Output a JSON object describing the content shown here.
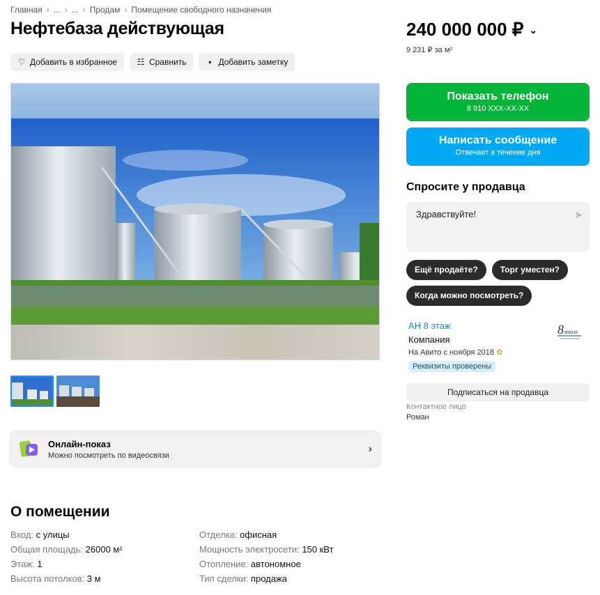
{
  "breadcrumbs": [
    "Главная",
    "...",
    "...",
    "Продам",
    "Помещение свободного назначения"
  ],
  "title": "Нефтебаза действующая",
  "price": {
    "value": "240 000 000 ₽",
    "per_m2": "9 231 ₽ за м²"
  },
  "actions": {
    "favorite": "Добавить в избранное",
    "compare": "Сравнить",
    "note": "Добавить заметку"
  },
  "buttons": {
    "show_phone": "Показать телефон",
    "phone_mask": "8 910 XXX-XX-XX",
    "write_message": "Написать сообщение",
    "reply_time": "Отвечает в течение дня"
  },
  "ask": {
    "title": "Спросите у продавца",
    "message": "Здравствуйте!",
    "chips": [
      "Ещё продаёте?",
      "Торг уместен?",
      "Когда можно посмотреть?"
    ]
  },
  "seller": {
    "name": "АН 8 этаж",
    "type": "Компания",
    "since": "На Авито с ноября 2018",
    "badge": "Реквизиты проверены",
    "subscribe": "Подписаться на продавца",
    "contact_label": "Контактное лицо",
    "contact_name": "Роман",
    "logo_text": "8 этаж"
  },
  "online": {
    "title": "Онлайн-показ",
    "subtitle": "Можно посмотреть по видеосвязи"
  },
  "about": {
    "title": "О помещении",
    "props": [
      {
        "k": "Вход:",
        "v": "с улицы"
      },
      {
        "k": "Отделка:",
        "v": "офисная"
      },
      {
        "k": "Общая площадь:",
        "v": "26000 м²"
      },
      {
        "k": "Мощность электросети:",
        "v": "150 кВт"
      },
      {
        "k": "Этаж:",
        "v": "1"
      },
      {
        "k": "Отопление:",
        "v": "автономное"
      },
      {
        "k": "Высота потолков:",
        "v": "3 м"
      },
      {
        "k": "Тип сделки:",
        "v": "продажа"
      }
    ]
  },
  "colors": {
    "green": "#04b53a",
    "blue": "#00a9f4",
    "link": "#0a8fd6"
  }
}
